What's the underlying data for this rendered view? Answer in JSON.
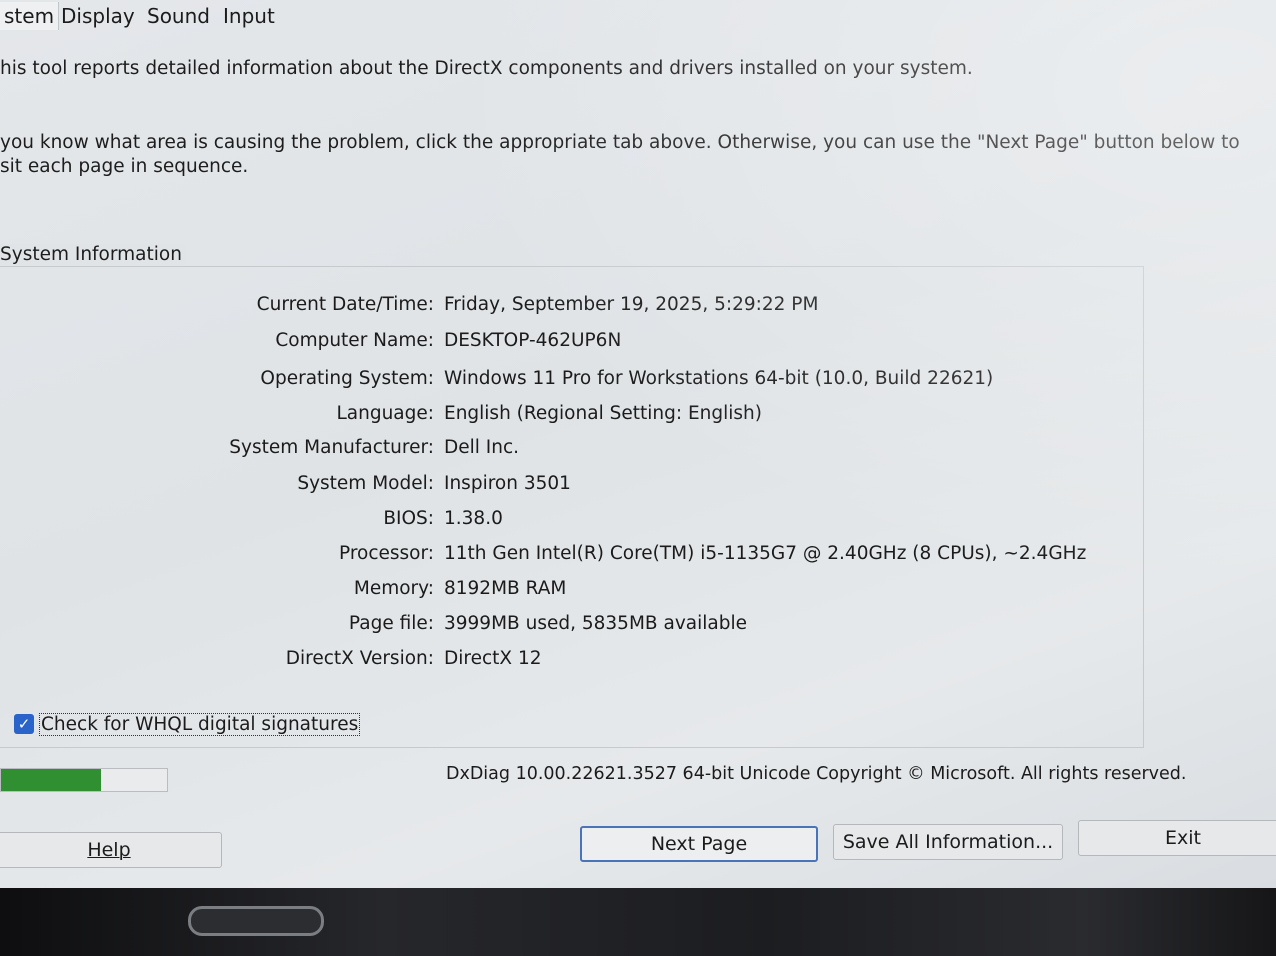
{
  "tabs": [
    {
      "label": "stem",
      "active": true
    },
    {
      "label": "Display",
      "active": false
    },
    {
      "label": "Sound",
      "active": false
    },
    {
      "label": "Input",
      "active": false
    }
  ],
  "intro": {
    "line1": "his tool reports detailed information about the DirectX components and drivers installed on your system.",
    "line2": " you know what area is causing the problem, click the appropriate tab above.  Otherwise, you can use the \"Next Page\" button below to",
    "line3": "sit each page in sequence."
  },
  "system_info": {
    "title": "System Information",
    "rows": [
      {
        "label": "Current Date/Time:",
        "value": "Friday, September 19, 2025, 5:29:22 PM"
      },
      {
        "label": "Computer Name:",
        "value": "DESKTOP-462UP6N"
      },
      {
        "label": "Operating System:",
        "value": "Windows 11 Pro for Workstations 64-bit (10.0, Build 22621)"
      },
      {
        "label": "Language:",
        "value": "English (Regional Setting: English)"
      },
      {
        "label": "System Manufacturer:",
        "value": "Dell Inc."
      },
      {
        "label": "System Model:",
        "value": "Inspiron 3501"
      },
      {
        "label": "BIOS:",
        "value": "1.38.0"
      },
      {
        "label": "Processor:",
        "value": "11th Gen Intel(R) Core(TM) i5-1135G7 @ 2.40GHz (8 CPUs), ~2.4GHz"
      },
      {
        "label": "Memory:",
        "value": "8192MB RAM"
      },
      {
        "label": "Page file:",
        "value": "3999MB used, 5835MB available"
      },
      {
        "label": "DirectX Version:",
        "value": "DirectX 12"
      }
    ]
  },
  "whql": {
    "label": "Check for WHQL digital signatures",
    "checked": true
  },
  "progress": {
    "fraction": 0.6,
    "color": "#2f8f31"
  },
  "copyright": "DxDiag 10.00.22621.3527 64-bit Unicode  Copyright © Microsoft. All rights reserved.",
  "buttons": {
    "help": "Help",
    "next_page": "Next Page",
    "save_all": "Save All Information...",
    "exit": "Exit"
  },
  "accent": "#2a63c9"
}
